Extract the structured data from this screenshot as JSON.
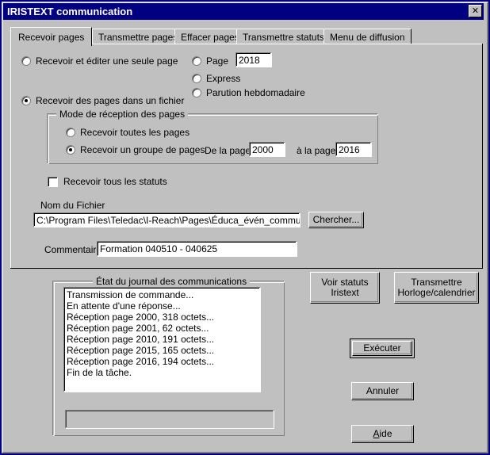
{
  "window": {
    "title": "IRISTEXT communication",
    "close_icon": "close-icon",
    "close_glyph": "✕",
    "colors": {
      "titlebar": "#000080",
      "face": "#c0c0c0",
      "field": "#ffffff",
      "text": "#000000"
    }
  },
  "tabs": [
    {
      "label": "Recevoir pages",
      "selected": true
    },
    {
      "label": "Transmettre pages",
      "selected": false
    },
    {
      "label": "Effacer pages",
      "selected": false
    },
    {
      "label": "Transmettre statuts",
      "selected": false
    },
    {
      "label": "Menu de diffusion",
      "selected": false
    }
  ],
  "receive_mode": {
    "single_page": {
      "label": "Recevoir et éditer une seule page",
      "checked": false
    },
    "to_file": {
      "label": "Recevoir des pages dans un fichier",
      "checked": true
    }
  },
  "page_type": {
    "page": {
      "label": "Page",
      "checked": false
    },
    "page_value": "2018",
    "express": {
      "label": "Express",
      "checked": false
    },
    "weekly": {
      "label": "Parution hebdomadaire",
      "checked": false
    }
  },
  "page_mode_group": {
    "title": "Mode de réception des pages",
    "all_pages": {
      "label": "Recevoir toutes les pages",
      "checked": false
    },
    "group_pages": {
      "label": "Recevoir un groupe de pages",
      "checked": true
    },
    "from_label": "De la page:",
    "from_value": "2000",
    "to_label": "à la page:",
    "to_value": "2016"
  },
  "all_statuses": {
    "label": "Recevoir tous les statuts",
    "checked": false
  },
  "file": {
    "label": "Nom du Fichier",
    "value": "C:\\Program Files\\Teledac\\I-Reach\\Pages\\Éduca_évén_communs",
    "browse_label": "Chercher..."
  },
  "comment": {
    "label": "Commentaire",
    "value": "Formation 040510 - 040625"
  },
  "log": {
    "title": "État du journal des communications",
    "lines": [
      "Transmission de commande...",
      "En attente d'une réponse...",
      "Réception page 2000, 318 octets...",
      "Réception page 2001, 62 octets...",
      "Réception page 2010, 191 octets...",
      "Réception page 2015, 165 octets...",
      "Réception page 2016, 194 octets...",
      "Fin de la tâche."
    ]
  },
  "progress": {
    "value": ""
  },
  "buttons": {
    "view_status_line1": "Voir statuts",
    "view_status_line2": "Iristext",
    "transmit_clock_line1": "Transmettre",
    "transmit_clock_line2": "Horloge/calendrier",
    "execute": "Exécuter",
    "cancel": "Annuler",
    "help_accel": "A",
    "help_rest": "ide"
  }
}
